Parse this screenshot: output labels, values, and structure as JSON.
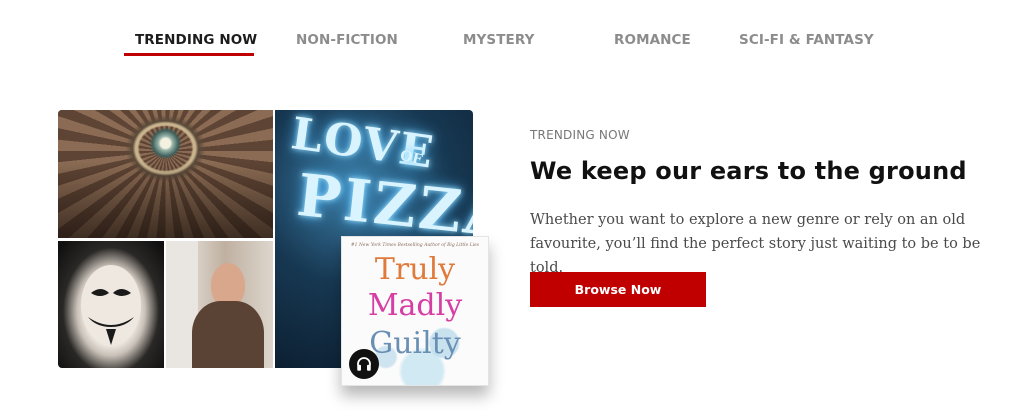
{
  "tabs": [
    {
      "label": "TRENDING NOW",
      "active": true
    },
    {
      "label": "NON-FICTION",
      "active": false
    },
    {
      "label": "MYSTERY",
      "active": false
    },
    {
      "label": "ROMANCE",
      "active": false
    },
    {
      "label": "SCI-FI & FANTASY",
      "active": false
    }
  ],
  "collage": {
    "tiles": [
      "dome-photo",
      "guy-fawkes-mask-photo",
      "woman-portrait-photo",
      "neon-sign-photo"
    ],
    "neon_sign": {
      "line1": "LOVE",
      "line2": "OF",
      "line3": "PIZZA"
    }
  },
  "featured_book": {
    "tagline": "#1 New York Times Bestselling Author of Big Little Lies",
    "title_line1": "Truly",
    "title_line2": "Madly",
    "title_line3": "Guilty",
    "badge_icon": "headphones-icon"
  },
  "section": {
    "label": "TRENDING NOW",
    "heading": "We keep our ears to the ground",
    "body": "Whether you want to explore a new genre or rely on an old favourite, you’ll find the perfect story just waiting to be to be told.",
    "cta_label": "Browse Now"
  },
  "colors": {
    "accent": "#c00000",
    "active_tab": "#1c1c1c",
    "inactive_tab": "#8c8c8c"
  }
}
